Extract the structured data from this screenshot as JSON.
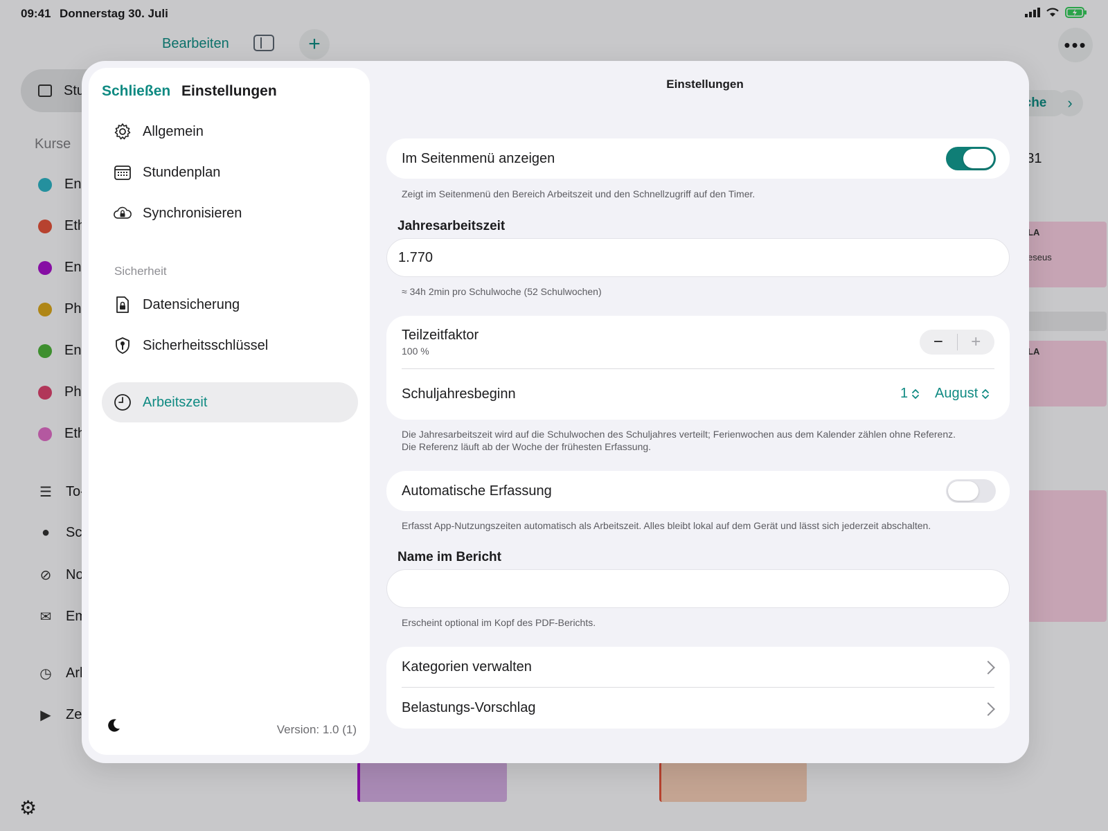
{
  "status_bar": {
    "time": "09:41",
    "date": "Donnerstag 30. Juli"
  },
  "background": {
    "toolbar": {
      "edit_label": "Bearbeiten"
    },
    "nav_selected_label": "Stu",
    "courses_section": "Kurse",
    "courses": [
      {
        "label": "En",
        "color": "#2cb0c1"
      },
      {
        "label": "Eth",
        "color": "#e0513a"
      },
      {
        "label": "En",
        "color": "#a412c9"
      },
      {
        "label": "Ph",
        "color": "#d6a41c"
      },
      {
        "label": "En",
        "color": "#4caf3a"
      },
      {
        "label": "Ph",
        "color": "#d8436d"
      },
      {
        "label": "Eth",
        "color": "#dc6cc4"
      }
    ],
    "side_items": [
      {
        "label": "To-",
        "icon": "checklist-icon"
      },
      {
        "label": "Sc",
        "icon": "people-icon"
      },
      {
        "label": "No",
        "icon": "no-entry-icon"
      },
      {
        "label": "Em",
        "icon": "envelope-icon"
      },
      {
        "label": "Arl",
        "icon": "clock-icon"
      },
      {
        "label": "Ze",
        "icon": "play-icon"
      }
    ],
    "week_label": "che",
    "day_label": "r 31",
    "event_texts": [
      "LA",
      "eseus",
      "LA"
    ]
  },
  "modal": {
    "sidebar": {
      "close_label": "Schließen",
      "title": "Einstellungen",
      "items": [
        {
          "label": "Allgemein",
          "icon": "gear-icon"
        },
        {
          "label": "Stundenplan",
          "icon": "calendar-icon"
        },
        {
          "label": "Synchronisieren",
          "icon": "cloud-lock-icon"
        }
      ],
      "security_section": "Sicherheit",
      "security_items": [
        {
          "label": "Datensicherung",
          "icon": "document-lock-icon"
        },
        {
          "label": "Sicherheitsschlüssel",
          "icon": "key-shield-icon"
        }
      ],
      "active_item": {
        "label": "Arbeitszeit",
        "icon": "clock-icon"
      },
      "version": "Version: 1.0 (1)"
    },
    "content": {
      "title": "Einstellungen",
      "show_in_sidebar": {
        "label": "Im Seitenmenü anzeigen",
        "enabled": true,
        "footnote": "Zeigt im Seitenmenü den Bereich Arbeitszeit und den Schnellzugriff auf den Timer."
      },
      "annual_hours": {
        "heading": "Jahresarbeitszeit",
        "value": "1.770",
        "footnote": "≈ 34h 2min pro Schulwoche (52 Schulwochen)"
      },
      "part_time": {
        "label": "Teilzeitfaktor",
        "value": "100 %",
        "minus": "−",
        "plus": "+"
      },
      "school_year_start": {
        "label": "Schuljahresbeginn",
        "day": "1",
        "month": "August"
      },
      "distribution_footnote_1": "Die Jahresarbeitszeit wird auf die Schulwochen des Schuljahres verteilt; Ferienwochen aus dem Kalender zählen ohne Referenz.",
      "distribution_footnote_2": "Die Referenz läuft ab der Woche der frühesten Erfassung.",
      "auto_tracking": {
        "label": "Automatische Erfassung",
        "enabled": false,
        "footnote": "Erfasst App-Nutzungszeiten automatisch als Arbeitszeit. Alles bleibt lokal auf dem Gerät und lässt sich jederzeit abschalten."
      },
      "report_name": {
        "heading": "Name im Bericht",
        "value": "",
        "placeholder": "",
        "footnote": "Erscheint optional im Kopf des PDF-Berichts."
      },
      "links": [
        {
          "label": "Kategorien verwalten"
        },
        {
          "label": "Belastungs-Vorschlag"
        }
      ]
    }
  },
  "colors": {
    "accent": "#0f8a82",
    "toggle_on": "#0f7e76"
  }
}
